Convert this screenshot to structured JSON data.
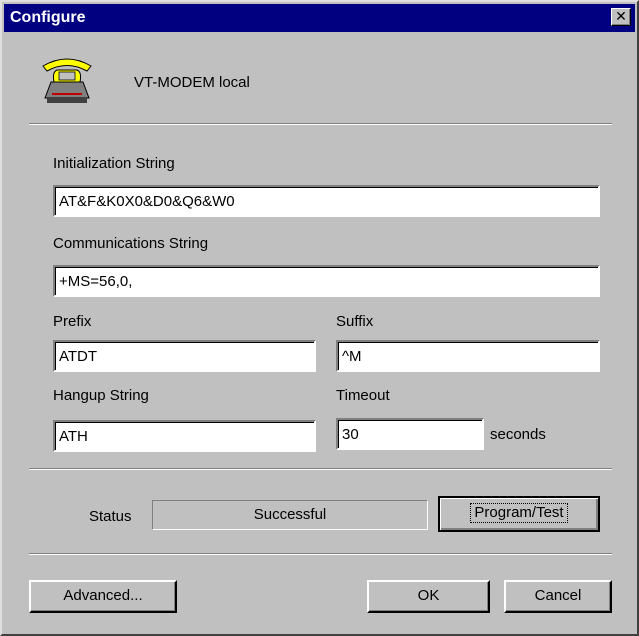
{
  "window": {
    "title": "Configure"
  },
  "titlebar": {
    "close_glyph": "✕"
  },
  "header": {
    "device_name": "VT-MODEM local",
    "icon": "telephone-icon"
  },
  "fields": {
    "init_label": "Initialization String",
    "init_value": "AT&F&K0X0&D0&Q6&W0",
    "comm_label": "Communications String",
    "comm_value": "+MS=56,0,",
    "prefix_label": "Prefix",
    "prefix_value": "ATDT",
    "suffix_label": "Suffix",
    "suffix_value": "^M",
    "hangup_label": "Hangup String",
    "hangup_value": "ATH",
    "timeout_label": "Timeout",
    "timeout_value": "30",
    "timeout_unit": "seconds"
  },
  "status": {
    "label": "Status",
    "value": "Successful"
  },
  "buttons": {
    "program_test": "Program/Test",
    "advanced": "Advanced...",
    "ok": "OK",
    "cancel": "Cancel"
  }
}
